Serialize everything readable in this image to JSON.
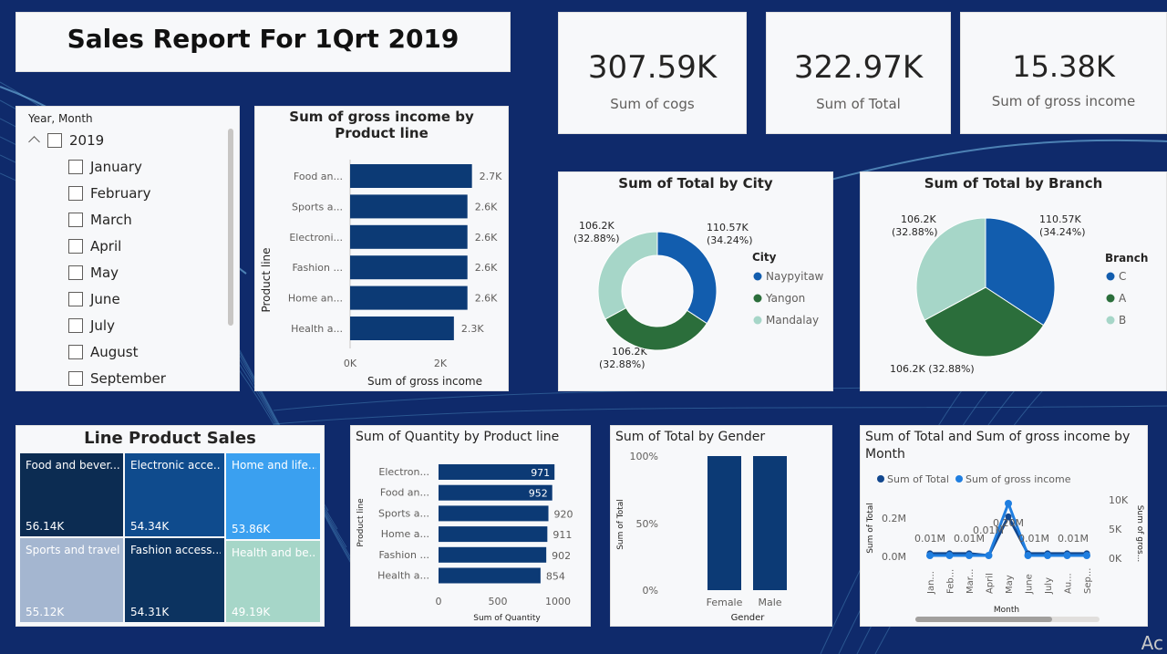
{
  "report": {
    "title": "Sales  Report For 1Qrt 2019"
  },
  "kpis": [
    {
      "value": "307.59K",
      "label": "Sum of cogs"
    },
    {
      "value": "322.97K",
      "label": "Sum of Total"
    },
    {
      "value": "15.38K",
      "label": "Sum of gross income"
    }
  ],
  "slicer": {
    "header": "Year, Month",
    "year": "2019",
    "months": [
      "January",
      "February",
      "March",
      "April",
      "May",
      "June",
      "July",
      "August",
      "September"
    ]
  },
  "colors": {
    "dark_blue": "#12478e",
    "navy": "#0c3a75",
    "green": "#2b6e3b",
    "mint": "#a6d6c8",
    "blue": "#125dae",
    "light_blue": "#a4b6d0",
    "sky": "#3aa0f0",
    "background": "#0f2a6b"
  },
  "gross_by_product": {
    "title": "Sum of gross income by Product line",
    "ylabel": "Product line",
    "xlabel": "Sum of gross income",
    "ticks": [
      "0K",
      "2K"
    ]
  },
  "city": {
    "title": "Sum of Total by City",
    "legend_title": "City",
    "labels": [
      "110.57K\n(34.24%)",
      "106.2K\n(32.88%)",
      "106.2K\n(32.88%)"
    ]
  },
  "branch": {
    "title": "Sum of Total by Branch",
    "legend_title": "Branch",
    "labels": [
      "110.57K\n(34.24%)",
      "106.2K (32.88%)",
      "106.2K\n(32.88%)"
    ]
  },
  "treemap": {
    "title": "Line Product Sales",
    "cells": [
      {
        "label": "Food and bever...",
        "value": "56.14K"
      },
      {
        "label": "Electronic acce...",
        "value": "54.34K"
      },
      {
        "label": "Home and life...",
        "value": "53.86K"
      },
      {
        "label": "Sports and travel",
        "value": "55.12K"
      },
      {
        "label": "Fashion access...",
        "value": "54.31K"
      },
      {
        "label": "Health and be...",
        "value": "49.19K"
      }
    ]
  },
  "quantity": {
    "title": "Sum of Quantity by Product line",
    "ylabel": "Product line",
    "xlabel": "Sum of Quantity",
    "ticks": [
      "0",
      "500",
      "1000"
    ]
  },
  "gender": {
    "title": "Sum of Total by Gender",
    "ylabel": "Sum of Total",
    "xlabel": "Gender",
    "ticks": [
      "100%",
      "50%",
      "0%"
    ]
  },
  "monthly": {
    "title": "Sum of Total and Sum of gross income by Month",
    "legend": [
      "Sum of Total",
      "Sum of gross income"
    ],
    "ylabel_left": "Sum of Total",
    "ylabel_right": "Sum of gros...",
    "xlabel": "Month",
    "left_ticks": [
      "0.2M",
      "0.0M"
    ],
    "right_ticks": [
      "10K",
      "5K",
      "0K"
    ],
    "point_labels": [
      "0.01M",
      "0.01M",
      "0.01M",
      "0.20M",
      "0.01M",
      "0.01M"
    ],
    "x_tick_labels": [
      "Jan...",
      "Feb...",
      "Mar...",
      "April",
      "May",
      "June",
      "July",
      "Au...",
      "Sep..."
    ]
  },
  "chart_data": [
    {
      "type": "bar",
      "title": "Sum of gross income by Product line",
      "categories": [
        "Food an...",
        "Sports a...",
        "Electroni...",
        "Fashion ...",
        "Home an...",
        "Health a..."
      ],
      "values": [
        2.7,
        2.6,
        2.6,
        2.6,
        2.6,
        2.3
      ],
      "data_labels": [
        "2.7K",
        "2.6K",
        "2.6K",
        "2.6K",
        "2.6K",
        "2.3K"
      ],
      "xlabel": "Sum of gross income",
      "ylabel": "Product line",
      "xlim": [
        0,
        2.9
      ]
    },
    {
      "type": "pie",
      "title": "Sum of Total by City",
      "categories": [
        "Naypyitaw",
        "Yangon",
        "Mandalay"
      ],
      "values": [
        110.57,
        106.2,
        106.2
      ]
    },
    {
      "type": "pie",
      "title": "Sum of Total by Branch",
      "categories": [
        "C",
        "A",
        "B"
      ],
      "values": [
        110.57,
        106.2,
        106.2
      ]
    },
    {
      "type": "bar",
      "title": "Sum of Quantity by Product line",
      "categories": [
        "Electron...",
        "Food an...",
        "Sports a...",
        "Home a...",
        "Fashion ...",
        "Health a..."
      ],
      "values": [
        971,
        952,
        920,
        911,
        902,
        854
      ],
      "xlabel": "Sum of Quantity",
      "ylabel": "Product line",
      "xlim": [
        0,
        1000
      ]
    },
    {
      "type": "bar",
      "title": "Sum of Total by Gender",
      "categories": [
        "Female",
        "Male"
      ],
      "values": [
        100,
        100
      ],
      "xlabel": "Gender",
      "ylabel": "Sum of Total",
      "ylim": [
        0,
        100
      ]
    },
    {
      "type": "line",
      "title": "Sum of Total and Sum of gross income by Month",
      "x": [
        "Jan...",
        "Feb...",
        "Mar...",
        "April",
        "May",
        "June",
        "July",
        "Au...",
        "Sep..."
      ],
      "series": [
        {
          "name": "Sum of Total",
          "values": [
            0.01,
            0.01,
            0.01,
            0.0,
            0.2,
            0.01,
            0.01,
            0.01,
            0.01
          ]
        },
        {
          "name": "Sum of gross income",
          "values": [
            0,
            0,
            0,
            0,
            9.5,
            0,
            0,
            0,
            0
          ]
        }
      ],
      "ylim_left": [
        0,
        0.3
      ],
      "ylim_right": [
        0,
        10
      ]
    }
  ]
}
